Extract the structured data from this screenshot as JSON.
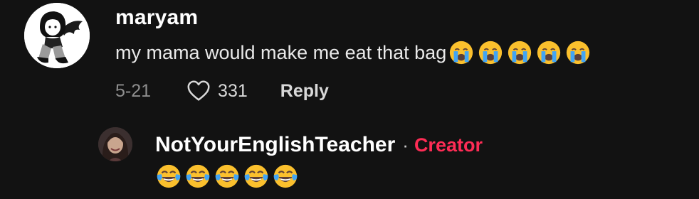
{
  "comment": {
    "username": "maryam",
    "text": "my mama would make me eat that bag",
    "emojis": [
      "loudly-crying-face",
      "loudly-crying-face",
      "loudly-crying-face",
      "loudly-crying-face",
      "loudly-crying-face"
    ],
    "date": "5-21",
    "like_count": "331",
    "reply_label": "Reply",
    "avatar_icon": "anime-girl-avatar",
    "like_icon": "heart-outline-icon"
  },
  "reply": {
    "username": "NotYourEnglishTeacher",
    "separator": "·",
    "badge": "Creator",
    "emojis": [
      "face-with-tears-of-joy",
      "face-with-tears-of-joy",
      "face-with-tears-of-joy",
      "face-with-tears-of-joy",
      "face-with-tears-of-joy"
    ],
    "avatar_icon": "user-photo-avatar"
  },
  "colors": {
    "background": "#121212",
    "creator_badge": "#fe2c55",
    "meta_text": "#8e8e8e",
    "emoji_yellow": "#fbc02d",
    "tear_blue": "#42a5f5"
  }
}
